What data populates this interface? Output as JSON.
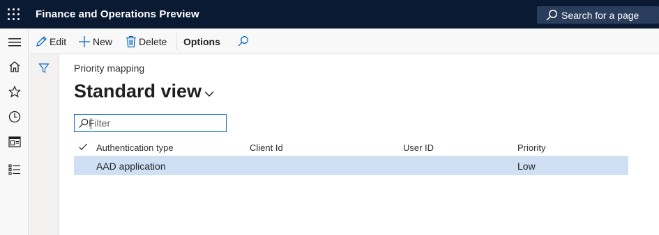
{
  "app": {
    "title": "Finance and Operations Preview",
    "search_label": "Search for a page"
  },
  "navrail": {
    "items": [
      "hamburger-menu",
      "home",
      "favorites",
      "recent",
      "workspaces",
      "modules"
    ]
  },
  "actions": {
    "edit": "Edit",
    "new": "New",
    "delete": "Delete",
    "options": "Options"
  },
  "page": {
    "caption": "Priority mapping",
    "view_name": "Standard view",
    "filter_placeholder": "Filter"
  },
  "grid": {
    "columns": [
      "Authentication type",
      "Client Id",
      "User ID",
      "Priority"
    ],
    "rows": [
      {
        "authentication_type": "AAD application",
        "client_id": "",
        "user_id": "",
        "priority": "Low"
      }
    ]
  },
  "colors": {
    "topbar": "#0a1a33",
    "accent": "#0f6cbd",
    "selected_row": "#cfe0f5"
  }
}
